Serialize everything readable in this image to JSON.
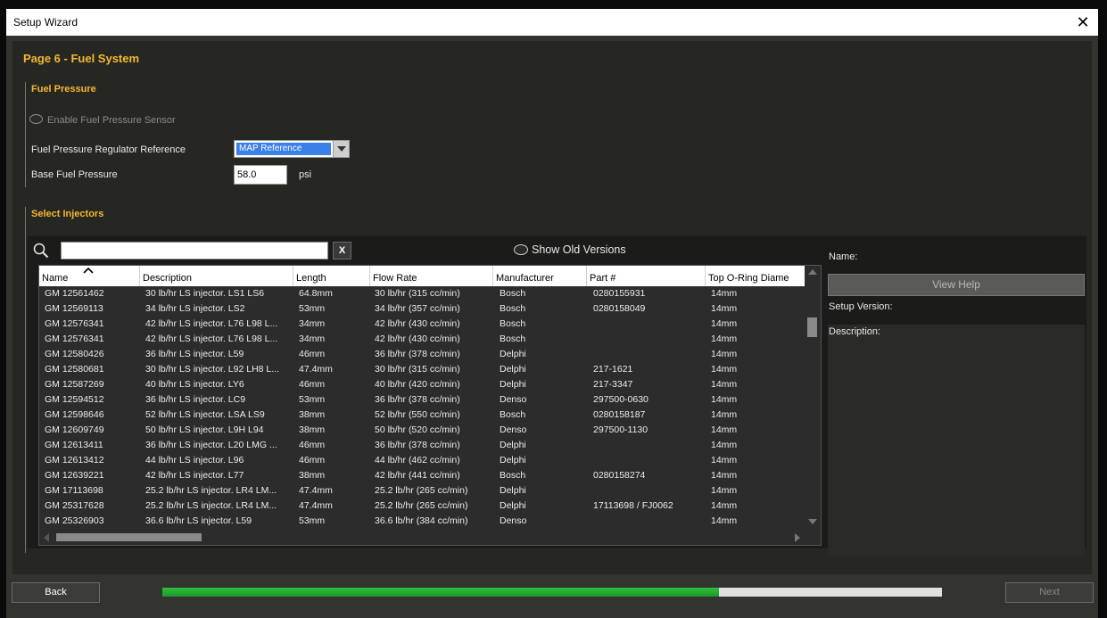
{
  "window": {
    "title": "Setup Wizard"
  },
  "page": {
    "title": "Page 6 - Fuel System"
  },
  "fuel_pressure": {
    "section_title": "Fuel Pressure",
    "enable_sensor_label": "Enable Fuel Pressure Sensor",
    "regulator_ref_label": "Fuel Pressure Regulator Reference",
    "regulator_ref_value": "MAP Reference",
    "base_pressure_label": "Base Fuel Pressure",
    "base_pressure_value": "58.0",
    "base_pressure_unit": "psi"
  },
  "injectors": {
    "section_title": "Select Injectors",
    "search_value": "",
    "clear_label": "X",
    "show_old_label": "Show Old Versions",
    "columns": [
      "Name",
      "Description",
      "Length",
      "Flow Rate",
      "Manufacturer",
      "Part #",
      "Top O-Ring Diame"
    ],
    "rows": [
      [
        "GM 12561462",
        "30 lb/hr LS injector. LS1 LS6",
        "64.8mm",
        "30 lb/hr (315 cc/min)",
        "Bosch",
        "0280155931",
        "14mm"
      ],
      [
        "GM 12569113",
        "34 lb/hr LS injector. LS2",
        "53mm",
        "34 lb/hr (357 cc/min)",
        "Bosch",
        "0280158049",
        "14mm"
      ],
      [
        "GM 12576341",
        "42 lb/hr LS injector. L76 L98 L...",
        "34mm",
        "42 lb/hr (430 cc/min)",
        "Bosch",
        "",
        "14mm"
      ],
      [
        "GM 12576341",
        "42 lb/hr LS injector. L76 L98 L...",
        "34mm",
        "42 lb/hr (430 cc/min)",
        "Bosch",
        "",
        "14mm"
      ],
      [
        "GM 12580426",
        "36 lb/hr LS injector. L59",
        "46mm",
        "36 lb/hr (378 cc/min)",
        "Delphi",
        "",
        "14mm"
      ],
      [
        "GM 12580681",
        "30 lb/hr LS injector. L92 LH8 L...",
        "47.4mm",
        "30 lb/hr (315 cc/min)",
        "Delphi",
        "217-1621",
        "14mm"
      ],
      [
        "GM 12587269",
        "40 lb/hr LS injector. LY6",
        "46mm",
        "40 lb/hr (420 cc/min)",
        "Delphi",
        "217-3347",
        "14mm"
      ],
      [
        "GM 12594512",
        "36 lb/hr LS injector. LC9",
        "53mm",
        "36 lb/hr (378 cc/min)",
        "Denso",
        "297500-0630",
        "14mm"
      ],
      [
        "GM 12598646",
        "52 lb/hr LS injector. LSA LS9",
        "38mm",
        "52 lb/hr (550 cc/min)",
        "Bosch",
        "0280158187",
        "14mm"
      ],
      [
        "GM 12609749",
        "50 lb/hr LS injector. L9H L94",
        "38mm",
        "50 lb/hr (520 cc/min)",
        "Denso",
        "297500-1130",
        "14mm"
      ],
      [
        "GM 12613411",
        "36 lb/hr LS injector. L20 LMG ...",
        "46mm",
        "36 lb/hr (378 cc/min)",
        "Delphi",
        "",
        "14mm"
      ],
      [
        "GM 12613412",
        "44 lb/hr LS injector. L96",
        "46mm",
        "44 lb/hr (462 cc/min)",
        "Delphi",
        "",
        "14mm"
      ],
      [
        "GM 12639221",
        "42 lb/hr LS injector. L77",
        "38mm",
        "42 lb/hr (441 cc/min)",
        "Bosch",
        "0280158274",
        "14mm"
      ],
      [
        "GM 17113698",
        "25.2 lb/hr LS injector. LR4 LM...",
        "47.4mm",
        "25.2 lb/hr (265 cc/min)",
        "Delphi",
        "",
        "14mm"
      ],
      [
        "GM 25317628",
        "25.2 lb/hr LS injector. LR4 LM...",
        "47.4mm",
        "25.2 lb/hr (265 cc/min)",
        "Delphi",
        "17113698 / FJ0062",
        "14mm"
      ],
      [
        "GM 25326903",
        "36.6 lb/hr LS injector. L59",
        "53mm",
        "36.6 lb/hr (384 cc/min)",
        "Denso",
        "",
        "14mm"
      ]
    ]
  },
  "details": {
    "name_label": "Name:",
    "view_help_label": "View Help",
    "setup_version_label": "Setup Version:",
    "description_label": "Description:"
  },
  "footer": {
    "back_label": "Back",
    "next_label": "Next",
    "progress_fraction": 0.714
  },
  "colors": {
    "accent": "#f5b830",
    "progress": "#2fbe3e",
    "selection": "#3a80e8"
  }
}
